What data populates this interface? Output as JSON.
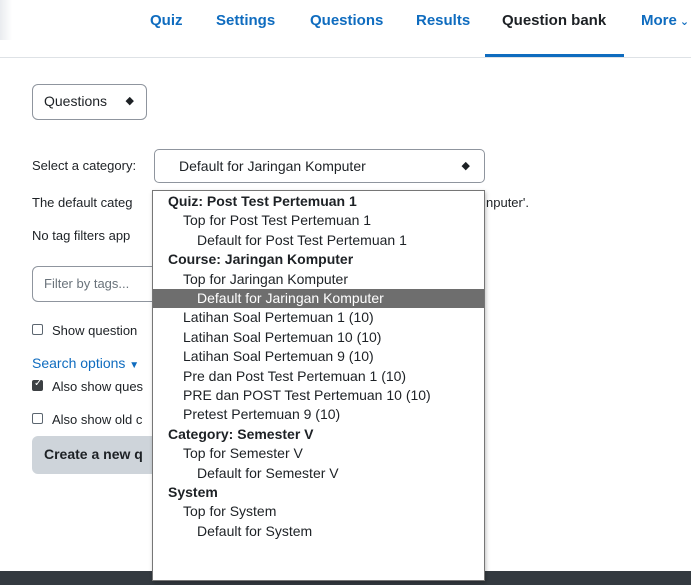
{
  "nav": {
    "tabs": [
      "Quiz",
      "Settings",
      "Questions",
      "Results",
      "Question bank"
    ],
    "active_tab": "Question bank",
    "more_label": "More"
  },
  "question_select": {
    "value": "Questions"
  },
  "category": {
    "label": "Select a category:",
    "value": "Default for Jaringan Komputer"
  },
  "info": {
    "default_text_start": "The default categ",
    "default_text_end": "nputer'.",
    "no_tag_text": "No tag filters app"
  },
  "tag_filter": {
    "placeholder": "Filter by tags..."
  },
  "options": {
    "show_question": "Show question",
    "search_options": "Search options",
    "also_show_ques": "Also show ques",
    "also_show_old": "Also show old c"
  },
  "create_button": "Create a new q",
  "dropdown": {
    "items": [
      {
        "text": "Quiz: Post Test Pertemuan 1",
        "level": "group"
      },
      {
        "text": "Top for Post Test Pertemuan 1",
        "level": "l1"
      },
      {
        "text": "Default for Post Test Pertemuan 1",
        "level": "l2"
      },
      {
        "text": "Course: Jaringan Komputer",
        "level": "group"
      },
      {
        "text": "Top for Jaringan Komputer",
        "level": "l1"
      },
      {
        "text": "Default for Jaringan Komputer",
        "level": "l2",
        "selected": true
      },
      {
        "text": "Latihan Soal Pertemuan 1 (10)",
        "level": "l1"
      },
      {
        "text": "Latihan Soal Pertemuan 10 (10)",
        "level": "l1"
      },
      {
        "text": "Latihan Soal Pertemuan 9 (10)",
        "level": "l1"
      },
      {
        "text": "Pre dan Post Test Pertemuan 1 (10)",
        "level": "l1"
      },
      {
        "text": "PRE dan POST Test Pertemuan 10 (10)",
        "level": "l1"
      },
      {
        "text": "Pretest Pertemuan 9 (10)",
        "level": "l1"
      },
      {
        "text": "Category: Semester V",
        "level": "group"
      },
      {
        "text": "Top for Semester V",
        "level": "l1"
      },
      {
        "text": "Default for Semester V",
        "level": "l2"
      },
      {
        "text": "System",
        "level": "group"
      },
      {
        "text": "Top for System",
        "level": "l1"
      },
      {
        "text": "Default for System",
        "level": "l2"
      }
    ]
  },
  "colors": {
    "link": "#0f6cbf",
    "selected_option_bg": "#6e6e6e",
    "footer": "#343a40"
  }
}
